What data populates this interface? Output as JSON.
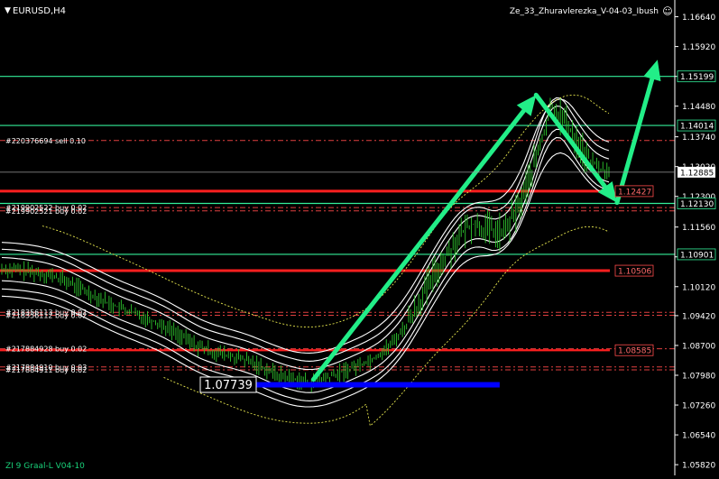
{
  "header": {
    "symbol_label": "EURUSD,H4",
    "indicator_label": "Ze_33_Zhuravlerezka_V-04-03_Ibush"
  },
  "footer": {
    "indicator_label": "ZI 9 Graal-L  V04-10"
  },
  "chart_data": {
    "type": "line",
    "title": "",
    "xlabel": "",
    "ylabel": "",
    "ylim": [
      1.0567,
      1.1687
    ],
    "y_ticks": [
      "1.16640",
      "1.15920",
      "1.15199",
      "1.14480",
      "1.13740",
      "1.13020",
      "1.12300",
      "1.11560",
      "1.10840",
      "1.10120",
      "1.09420",
      "1.08700",
      "1.07980",
      "1.07260",
      "1.06540",
      "1.05820"
    ],
    "grid": false,
    "x_range": [
      0,
      150
    ],
    "price_series": [
      [
        0,
        1.1055
      ],
      [
        4,
        1.1052
      ],
      [
        8,
        1.1047
      ],
      [
        12,
        1.104
      ],
      [
        16,
        1.1025
      ],
      [
        20,
        1.1005
      ],
      [
        24,
        1.0985
      ],
      [
        28,
        1.0965
      ],
      [
        32,
        1.095
      ],
      [
        36,
        1.0935
      ],
      [
        40,
        1.0918
      ],
      [
        44,
        1.0895
      ],
      [
        48,
        1.087
      ],
      [
        52,
        1.0855
      ],
      [
        56,
        1.0845
      ],
      [
        60,
        1.0835
      ],
      [
        64,
        1.082
      ],
      [
        68,
        1.08
      ],
      [
        72,
        1.079
      ],
      [
        76,
        1.078
      ],
      [
        80,
        1.079
      ],
      [
        84,
        1.0805
      ],
      [
        88,
        1.0822
      ],
      [
        92,
        1.084
      ],
      [
        96,
        1.087
      ],
      [
        100,
        1.092
      ],
      [
        104,
        1.099
      ],
      [
        108,
        1.106
      ],
      [
        112,
        1.112
      ],
      [
        116,
        1.1165
      ],
      [
        120,
        1.115
      ],
      [
        124,
        1.114
      ],
      [
        128,
        1.121
      ],
      [
        132,
        1.132
      ],
      [
        136,
        1.145
      ],
      [
        140,
        1.14
      ],
      [
        144,
        1.133
      ],
      [
        148,
        1.1295
      ],
      [
        150,
        1.129
      ]
    ],
    "current_price": "1.12885",
    "min_label": "1.07739",
    "level_lines": [
      {
        "price": 1.15199,
        "color": "#33ee99",
        "width": 1.2,
        "label": "1.15199"
      },
      {
        "price": 1.14014,
        "color": "#33ee99",
        "width": 1.2,
        "label": "1.14014"
      },
      {
        "price": 1.1213,
        "color": "#33ee99",
        "width": 1.2,
        "label": "1.12130"
      },
      {
        "price": 1.10901,
        "color": "#33ee99",
        "width": 1.2,
        "label": "1.10901"
      },
      {
        "price": 1.12427,
        "color": "#ff1f1f",
        "width": 3.0,
        "label": "1.12427"
      },
      {
        "price": 1.10506,
        "color": "#ff1f1f",
        "width": 3.0,
        "label": "1.10506"
      },
      {
        "price": 1.08585,
        "color": "#ff1f1f",
        "width": 2.2,
        "label": "1.08585"
      }
    ],
    "orders": [
      {
        "label": "#220376694 sell 0.10",
        "price": 1.1365
      },
      {
        "label": "#219902522 buy 0.02",
        "price": 1.1203
      },
      {
        "label": "#219902521 buy 0.02",
        "price": 1.1195
      },
      {
        "label": "#218356113 buy 0.02",
        "price": 1.095
      },
      {
        "label": "#218356112 buy 0.02",
        "price": 1.0943
      },
      {
        "label": "#217884928 buy 0.02",
        "price": 1.0862
      },
      {
        "label": "#217884910 buy 0.03",
        "price": 1.0818
      },
      {
        "label": "#217884911 buy 0.02",
        "price": 1.0811
      }
    ],
    "arrows": [
      {
        "from": [
          77,
          1.0788
        ],
        "to": [
          132,
          1.1475
        ]
      },
      {
        "from": [
          132,
          1.1475
        ],
        "to": [
          152,
          1.1215
        ]
      },
      {
        "from": [
          152,
          1.1215
        ],
        "to": [
          162,
          1.156
        ]
      }
    ],
    "colors": {
      "background": "#000000",
      "candles": "#2ec62e",
      "bands": "#ffffff",
      "dotted_band": "#e6e64d",
      "arrow": "#22ee88",
      "support_bar": "#0000ff"
    }
  }
}
